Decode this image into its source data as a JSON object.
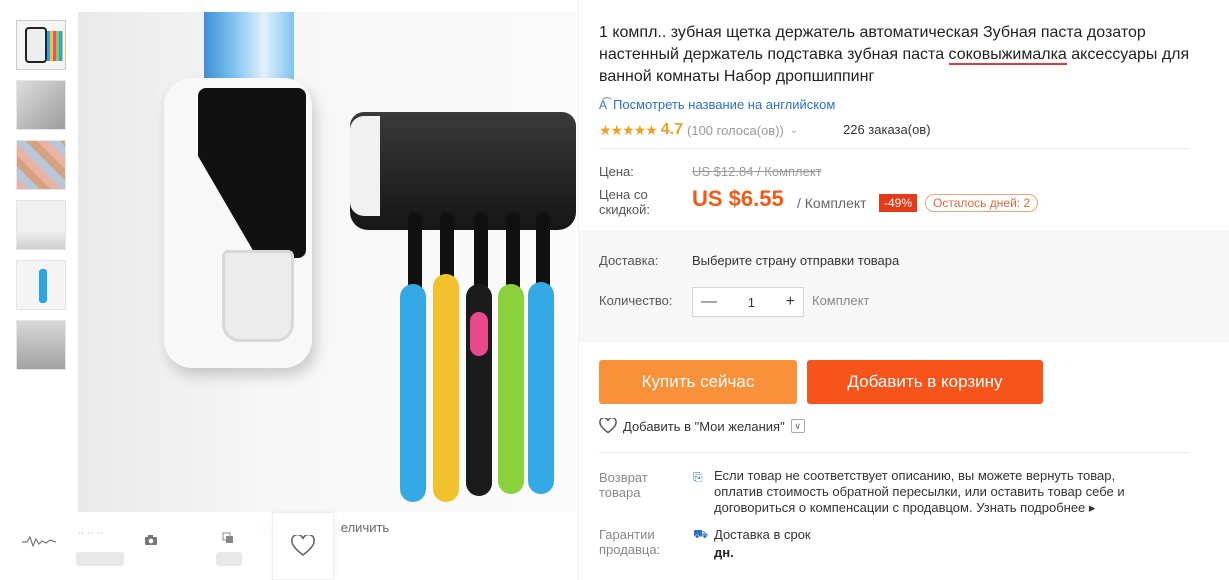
{
  "gallery": {
    "thumbnails": [
      "thumb-1",
      "thumb-2",
      "thumb-3",
      "thumb-4",
      "thumb-5",
      "thumb-6"
    ],
    "zoom_hint": "чтобы увеличить",
    "zoom_hint_partial": "и"
  },
  "product": {
    "title_part1": "1 компл.. зубная щетка держатель автоматическая Зубная паста дозатор настенный держатель подставка зубная паста ",
    "title_underlined": "соковыжималка",
    "title_part2": " аксессуары для ванной комнаты Набор дропшиппинг",
    "translate_link": "Посмотреть название на английском",
    "rating_stars": "★★★★★",
    "rating_value": "4.7",
    "votes": "(100 голоса(ов))",
    "orders": "226 заказа(ов)"
  },
  "price": {
    "price_label": "Цена:",
    "old_price": "US $12.84 / Комплект",
    "discount_label": "Цена со скидкой:",
    "new_price": "US $6.55",
    "unit": "/ Комплект",
    "discount_badge": "-49%",
    "days_left": "Осталось дней: 2"
  },
  "shipping": {
    "label": "Доставка:",
    "value": "Выберите страну отправки товара"
  },
  "quantity": {
    "label": "Количество:",
    "minus": "—",
    "value": "1",
    "plus": "+",
    "unit": "Комплект"
  },
  "actions": {
    "buy_now": "Купить сейчас",
    "add_to_cart": "Добавить в корзину",
    "wishlist": "Добавить в \"Мои желания\""
  },
  "returns": {
    "label": "Возврат товара",
    "text": "Если товар не соответствует описанию, вы можете вернуть товар, оплатив стоимость обратной пересылки, или оставить товар себе и договориться о компенсации с продавцом.",
    "more": "Узнать подробнее ▸"
  },
  "guarantee": {
    "label": "Гарантии продавца:",
    "line1": "Доставка в срок",
    "line2": "дн."
  },
  "colors": {
    "price_orange": "#f25a14",
    "buy_button": "#f8913a",
    "cart_button": "#f6541a",
    "link_blue": "#2a6fc9",
    "star_color": "#f0a020"
  }
}
